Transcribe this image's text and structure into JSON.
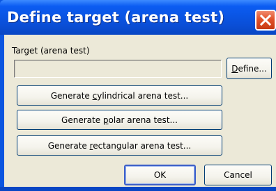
{
  "window": {
    "title": "Define target (arena test)"
  },
  "target": {
    "label": "Target (arena test)",
    "value": ""
  },
  "buttons": {
    "define": {
      "pre": "",
      "key": "D",
      "post": "efine..."
    },
    "cylindrical": {
      "pre": "Generate ",
      "key": "c",
      "post": "ylindrical arena test..."
    },
    "polar": {
      "pre": "Generate ",
      "key": "p",
      "post": "olar arena test..."
    },
    "rectangular": {
      "pre": "Generate ",
      "key": "r",
      "post": "ectangular arena test..."
    },
    "ok": "OK",
    "cancel": "Cancel"
  },
  "icons": {
    "close": "close-icon"
  },
  "colors": {
    "titlebar": "#0a4fd8",
    "close_button": "#e2522a",
    "dialog_face": "#ece9d8",
    "button_border": "#003c74"
  }
}
